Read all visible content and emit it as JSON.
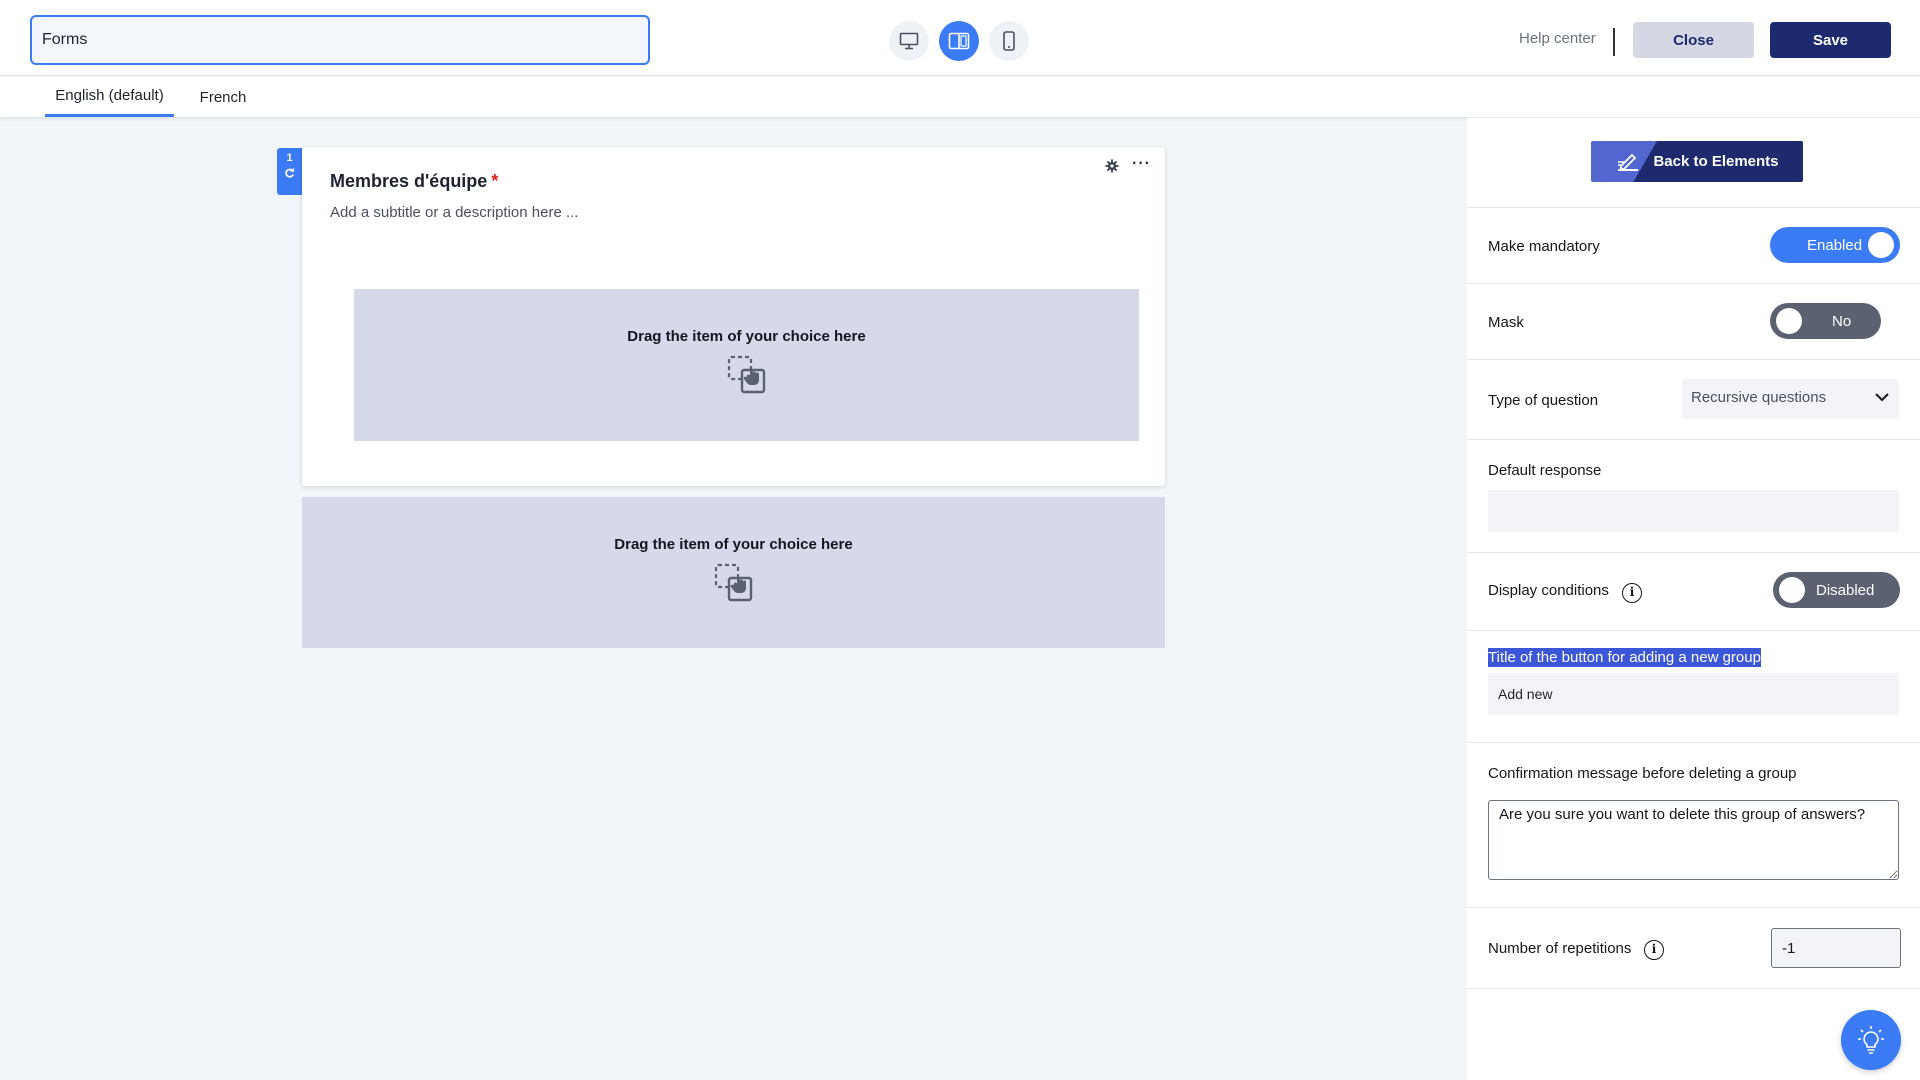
{
  "header": {
    "form_title_value": "Forms",
    "view_modes": [
      {
        "icon": "desktop-icon",
        "active": false
      },
      {
        "icon": "split-view-icon",
        "active": true
      },
      {
        "icon": "mobile-icon",
        "active": false
      }
    ],
    "help_label": "Help center",
    "close_label": "Close",
    "save_label": "Save"
  },
  "languages": {
    "tabs": [
      {
        "label": "English (default)",
        "active": true
      },
      {
        "label": "French",
        "active": false
      }
    ]
  },
  "canvas": {
    "question_number": "1",
    "question": {
      "title": "Membres d'équipe",
      "required_mark": "*",
      "subtitle": "Add a subtitle or a description here ...",
      "inner_dropzone_text": "Drag the item of your choice here"
    },
    "outer_dropzone_text": "Drag the item of your choice here"
  },
  "panel": {
    "back_label": "Back to Elements",
    "make_mandatory": {
      "label": "Make mandatory",
      "state": "Enabled"
    },
    "mask": {
      "label": "Mask",
      "state": "No"
    },
    "type_of_question": {
      "label": "Type of question",
      "value": "Recursive questions"
    },
    "default_response": {
      "label": "Default response",
      "value": ""
    },
    "display_conditions": {
      "label": "Display conditions",
      "state": "Disabled"
    },
    "add_group_button": {
      "label": "Title of the button for adding a new group",
      "value": "Add new"
    },
    "delete_confirmation": {
      "label": "Confirmation message before deleting a group",
      "value": "Are you sure you want to delete this group of answers?"
    },
    "repetitions": {
      "label": "Number of repetitions",
      "value": "-1"
    }
  },
  "colors": {
    "accent": "#3b7bf6",
    "navy": "#1d2a6e",
    "dropzone": "#d5d9ea",
    "toggle_off": "#5b6170",
    "required": "#e02020"
  }
}
